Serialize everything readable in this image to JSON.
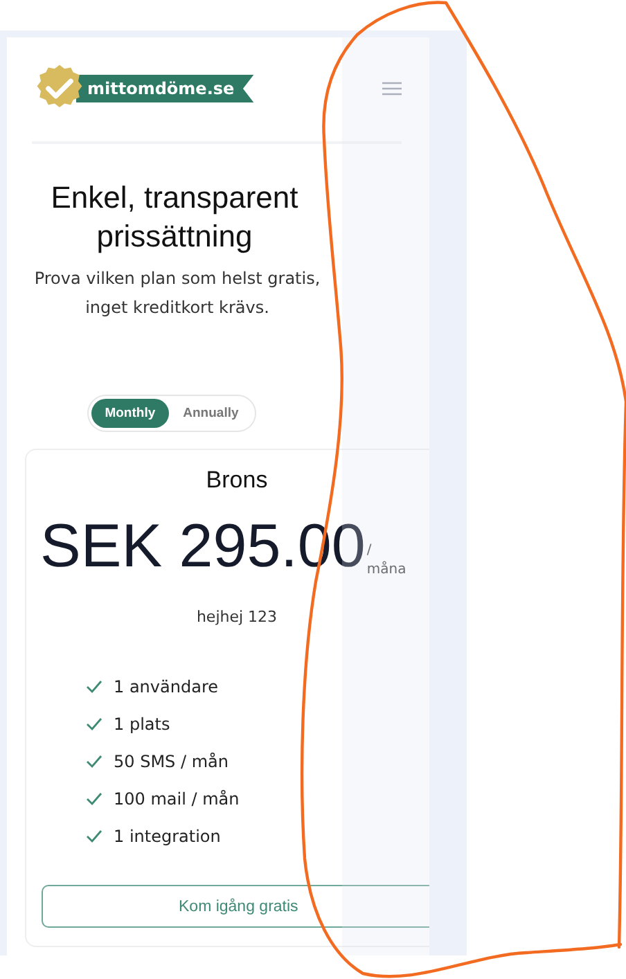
{
  "header": {
    "logo_text": "mittomdöme.se"
  },
  "hero": {
    "title": "Enkel, transparent prissättning",
    "subtitle": "Prova vilken plan som helst gratis, inget kreditkort krävs."
  },
  "billing_toggle": [
    {
      "label": "Monthly",
      "selected": true
    },
    {
      "label": "Annually",
      "selected": false
    }
  ],
  "plan": {
    "name": "Brons",
    "price": "SEK 295.00",
    "period": "/måna",
    "description": "hejhej 123",
    "features": [
      {
        "label": "1 användare",
        "included": true
      },
      {
        "label": "1 plats",
        "included": true
      },
      {
        "label": "50 SMS / mån",
        "included": true
      },
      {
        "label": "100 mail / mån",
        "included": true
      },
      {
        "label": "1 integration",
        "included": true
      }
    ],
    "cta": "Kom igång gratis"
  }
}
